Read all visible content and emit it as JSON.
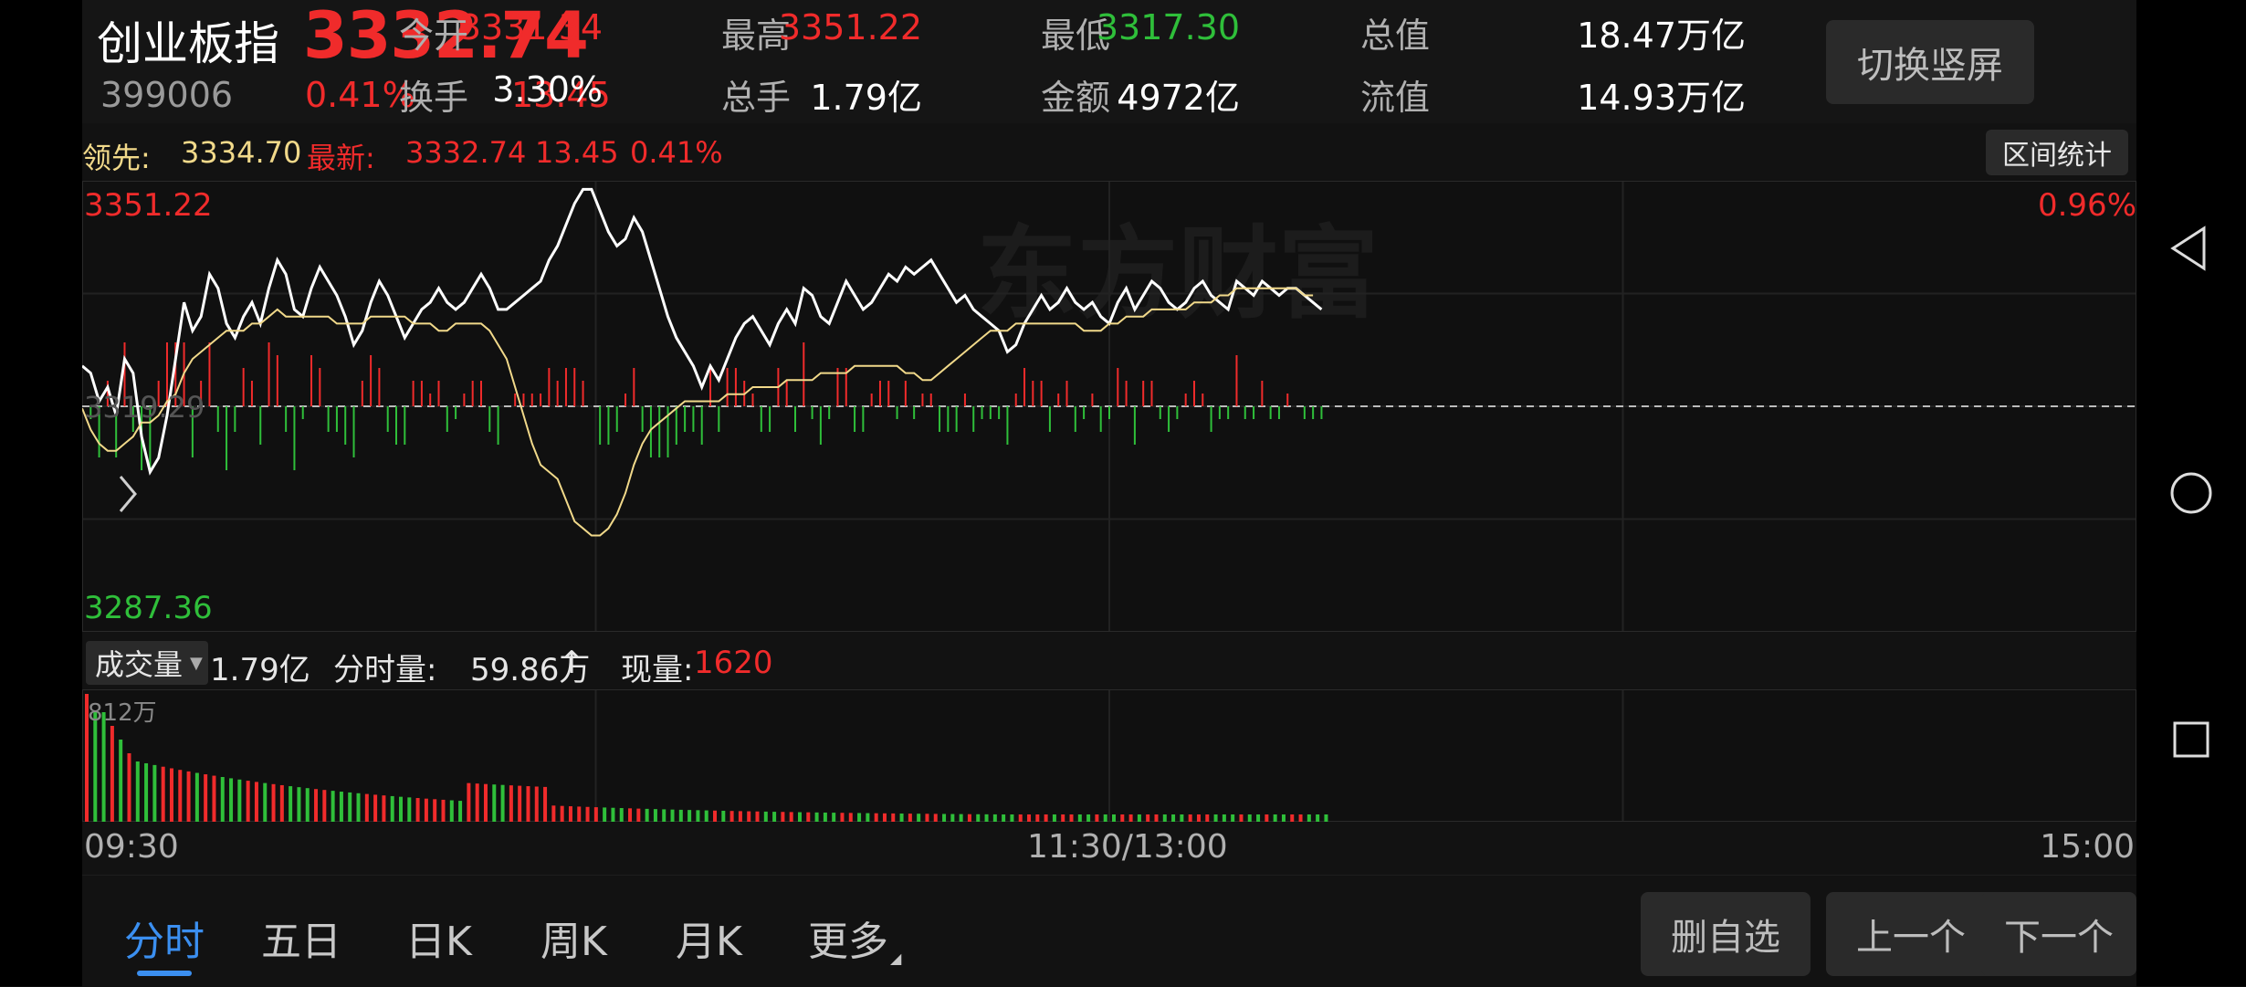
{
  "header": {
    "name": "创业板指",
    "price": "3332.74",
    "code": "399006",
    "change_pct": "0.41%",
    "change": "13.45",
    "stats": [
      {
        "label": "今开",
        "value": "3331.34",
        "color": "#f02b2b"
      },
      {
        "label": "最高",
        "value": "3351.22",
        "color": "#f02b2b"
      },
      {
        "label": "最低",
        "value": "3317.30",
        "color": "#2fbf3a"
      },
      {
        "label": "总值",
        "value": "18.47万亿",
        "color": "#ffffff"
      },
      {
        "label": "换手",
        "value": "3.30%",
        "color": "#ffffff"
      },
      {
        "label": "总手",
        "value": "1.79亿",
        "color": "#ffffff"
      },
      {
        "label": "金额",
        "value": "4972亿",
        "color": "#ffffff"
      },
      {
        "label": "流值",
        "value": "14.93万亿",
        "color": "#ffffff"
      }
    ],
    "switch_button": "切换竖屏"
  },
  "info_line": {
    "lead_label": "领先:",
    "lead_value": "3334.70",
    "latest_label": "最新:",
    "latest_value": "3332.74",
    "latest_change": "13.45",
    "latest_pct": "0.41%",
    "range_button": "区间统计"
  },
  "axis": {
    "high": "3351.22",
    "low": "3287.36",
    "prev_close": "3319.29",
    "high_pct": "0.96%",
    "time_start": "09:30",
    "time_mid": "11:30/13:00",
    "time_end": "15:00"
  },
  "watermark": "东方财富",
  "volume_header": {
    "selector": "成交量",
    "total": "1.79亿",
    "minute_label": "分时量:",
    "minute_value": "59.86万",
    "minute_arrow": "↑",
    "current_label": "现量:",
    "current_value": "1620",
    "max_label": "812万"
  },
  "tabs": [
    {
      "label": "分时",
      "active": true
    },
    {
      "label": "五日",
      "active": false
    },
    {
      "label": "日K",
      "active": false
    },
    {
      "label": "周K",
      "active": false
    },
    {
      "label": "月K",
      "active": false
    },
    {
      "label": "更多",
      "active": false
    }
  ],
  "actions": {
    "remove_watch": "删自选",
    "prev": "上一个",
    "next": "下一个"
  },
  "colors": {
    "up": "#f02b2b",
    "down": "#2fbf3a",
    "price_line": "#ffffff",
    "avg_line": "#f1d98a",
    "lead_color": "#f1d98a",
    "accent": "#3b8ff0"
  },
  "chart_data": {
    "type": "line",
    "x_range": [
      "09:30",
      "15:00"
    ],
    "ylim": [
      3287.36,
      3351.22
    ],
    "baseline": 3319.29,
    "series": [
      {
        "values": [
          3325,
          3324,
          3320,
          3322,
          3318,
          3326,
          3324,
          3315,
          3310,
          3312,
          3318,
          3326,
          3334,
          3330,
          3332,
          3338,
          3336,
          3331,
          3329,
          3332,
          3334,
          3331,
          3336,
          3340,
          3338,
          3333,
          3332,
          3336,
          3339,
          3337,
          3335,
          3332,
          3328,
          3330,
          3334,
          3337,
          3335,
          3332,
          3329,
          3331,
          3333,
          3334,
          3336,
          3334,
          3333,
          3334,
          3336,
          3338,
          3336,
          3333,
          3333,
          3334,
          3335,
          3336,
          3337,
          3340,
          3342,
          3345,
          3348,
          3350,
          3350,
          3347,
          3344,
          3342,
          3343,
          3346,
          3344,
          3340,
          3336,
          3332,
          3329,
          3327,
          3325,
          3322,
          3325,
          3323,
          3326,
          3329,
          3331,
          3332,
          3330,
          3328,
          3331,
          3333,
          3331,
          3336,
          3335,
          3332,
          3331,
          3334,
          3337,
          3335,
          3333,
          3334,
          3336,
          3338,
          3337,
          3339,
          3338,
          3339,
          3340,
          3338,
          3336,
          3334,
          3335,
          3333,
          3332,
          3331,
          3330,
          3327,
          3328,
          3331,
          3333,
          3335,
          3333,
          3334,
          3336,
          3334,
          3333,
          3334,
          3332,
          3331,
          3334,
          3336,
          3333,
          3335,
          3337,
          3336,
          3334,
          3333,
          3334,
          3336,
          3337,
          3335,
          3334,
          3333,
          3337,
          3336,
          3335,
          3337,
          3336,
          3335,
          3336,
          3336,
          3335,
          3334,
          3333
        ]
      },
      {
        "values": [
          3319,
          3316,
          3314,
          3313,
          3313,
          3314,
          3315,
          3317,
          3317,
          3318,
          3320,
          3321,
          3324,
          3326,
          3327,
          3328,
          3329,
          3330,
          3330,
          3330,
          3331,
          3331,
          3332,
          3333,
          3332,
          3332,
          3332,
          3332,
          3332,
          3332,
          3331,
          3331,
          3331,
          3331,
          3332,
          3332,
          3332,
          3332,
          3332,
          3331,
          3331,
          3331,
          3330,
          3330,
          3331,
          3331,
          3331,
          3331,
          3330,
          3328,
          3326,
          3322,
          3318,
          3314,
          3311,
          3310,
          3309,
          3306,
          3303,
          3302,
          3301,
          3301,
          3302,
          3304,
          3307,
          3311,
          3314,
          3316,
          3317,
          3318,
          3319,
          3320,
          3320,
          3320,
          3320,
          3320,
          3321,
          3321,
          3321,
          3322,
          3322,
          3322,
          3322,
          3323,
          3323,
          3323,
          3323,
          3324,
          3324,
          3324,
          3324,
          3325,
          3325,
          3325,
          3325,
          3325,
          3325,
          3324,
          3324,
          3323,
          3323,
          3324,
          3325,
          3326,
          3327,
          3328,
          3329,
          3330,
          3330,
          3330,
          3331,
          3331,
          3331,
          3331,
          3331,
          3331,
          3331,
          3331,
          3330,
          3330,
          3330,
          3331,
          3331,
          3332,
          3332,
          3332,
          3333,
          3333,
          3333,
          3333,
          3333,
          3334,
          3334,
          3334,
          3335,
          3335,
          3336,
          3336,
          3336,
          3336,
          3336,
          3336,
          3336,
          3336,
          3335,
          3335
        ]
      }
    ]
  }
}
